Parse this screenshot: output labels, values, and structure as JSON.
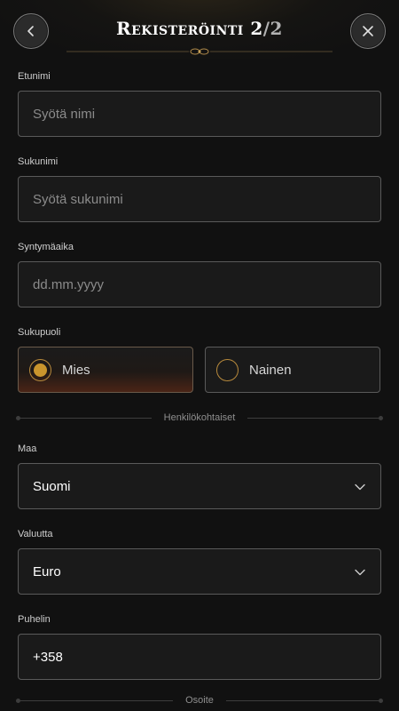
{
  "header": {
    "title_main": "Rekisteröinti",
    "title_step": "2",
    "title_total": "/2",
    "back_icon": "chevron-left-icon",
    "close_icon": "close-icon"
  },
  "form": {
    "first_name": {
      "label": "Etunimi",
      "placeholder": "Syötä nimi"
    },
    "last_name": {
      "label": "Sukunimi",
      "placeholder": "Syötä sukunimi"
    },
    "birth_date": {
      "label": "Syntymäaika",
      "placeholder": "dd.mm.yyyy"
    },
    "gender": {
      "label": "Sukupuoli",
      "options": [
        {
          "label": "Mies",
          "selected": true
        },
        {
          "label": "Nainen",
          "selected": false
        }
      ]
    },
    "section_personal": "Henkilökohtaiset",
    "country": {
      "label": "Maa",
      "value": "Suomi"
    },
    "currency": {
      "label": "Valuutta",
      "value": "Euro"
    },
    "phone": {
      "label": "Puhelin",
      "value": "+358"
    },
    "section_address": "Osoite"
  },
  "colors": {
    "accent_gold": "#c9952d",
    "background": "#111111",
    "field_border": "#5a5a5a"
  }
}
